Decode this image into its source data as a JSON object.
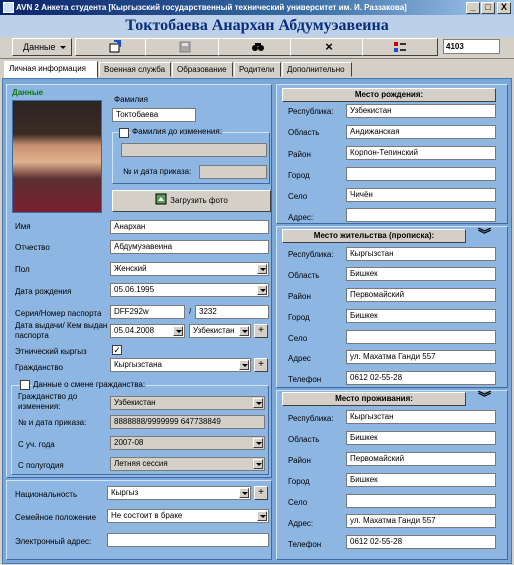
{
  "window": {
    "title": "AVN 2 Анкета студента [Кыргызский государственный технический университет им. И. Раззакова]",
    "min": "_",
    "max": "□",
    "close": "X"
  },
  "student_name": "Токтобаева Анархан Абдумуэавеина",
  "toolbar": {
    "data_label": "Данные",
    "record_id": "4103",
    "delete_glyph": "×"
  },
  "tabs": [
    "Личная информация",
    "Военная служба",
    "Образование",
    "Родители",
    "Дополнительно"
  ],
  "personal": {
    "section_title": "Данные",
    "lastname_label": "Фамилия",
    "lastname": "Токтобаева",
    "prev_lastname_label": "Фамилия до изменения:",
    "order_label": "№ и дата приказа:",
    "upload_label": "Загрузить фото",
    "firstname_label": "Имя",
    "firstname": "Анархан",
    "patronymic_label": "Отчество",
    "patronymic": "Абдумуэавеина",
    "gender_label": "Пол",
    "gender": "Женский",
    "birthdate_label": "Дата рождения",
    "birthdate": "05.06.1995",
    "passport_label": "Серия/Номер паспорта",
    "passport_series": "DFF292w",
    "passport_number": "3232",
    "issue_label": "Дата выдачи/ Кем выдан паспорта",
    "issue_date": "05.04.2008",
    "issued_by": "Узбекистан",
    "ethnic_label": "Этнический кыргыз",
    "citizenship_label": "Гражданство",
    "citizenship": "Кыргызстана",
    "citizenship_change_label": "Данные о смене гражданства:",
    "prev_citizenship_label": "Гражданство до изменения:",
    "prev_citizenship": "Узбекистан",
    "change_order_label": "№ и дата приказа:",
    "change_order": "8888888/9999999 647738849",
    "from_year_label": "С уч. года",
    "from_year": "2007-08",
    "from_semester_label": "С полугодия",
    "from_semester": "Летняя сессия",
    "nationality_label": "Национальность",
    "nationality": "Кыргыз",
    "marital_label": "Семейное положение",
    "marital": "Не состоит в браке",
    "email_label": "Электронный адрес:",
    "plus": "+"
  },
  "birth_place": {
    "title": "Место рождения:",
    "labels": [
      "Республика:",
      "Область",
      "Район",
      "Город",
      "Село",
      "Адрес:"
    ],
    "values": [
      "Узбекистан",
      "Андижанская",
      "Корпон-Тепинский",
      "",
      "Чичён",
      ""
    ]
  },
  "registration": {
    "title": "Место жительства (прописка):",
    "labels": [
      "Республика:",
      "Область",
      "Район",
      "Город",
      "Село",
      "Адрес",
      "Телефон"
    ],
    "values": [
      "Кыргызстан",
      "Бишкек",
      "Первомайский",
      "Бишкек",
      "",
      "ул. Махатма Ганди 557",
      "0612 02-55-28"
    ]
  },
  "residence": {
    "title": "Место проживания:",
    "labels": [
      "Республика:",
      "Область",
      "Район",
      "Город",
      "Село",
      "Адрес:",
      "Телефон"
    ],
    "values": [
      "Кыргызстан",
      "Бишкек",
      "Первомайский",
      "Бишкек",
      "",
      "ул. Махатма Ганди 557",
      "0612 02-55-28"
    ]
  },
  "icons": [
    "app-icon",
    "add-icon",
    "save-icon",
    "find-icon",
    "delete-icon",
    "filter-icon",
    "upload-icon",
    "chevron-double-down-icon"
  ]
}
